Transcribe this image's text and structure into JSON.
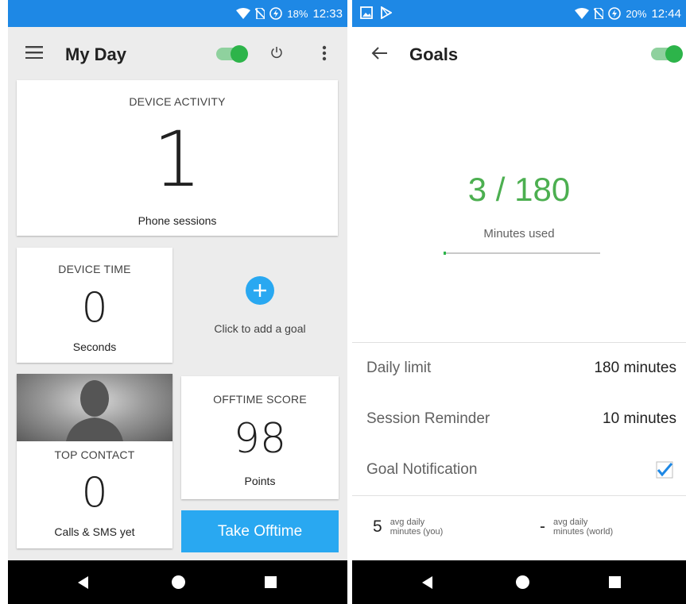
{
  "left": {
    "status": {
      "battery": "18%",
      "time": "12:33"
    },
    "appbar": {
      "title": "My Day"
    },
    "device_activity": {
      "title": "DEVICE ACTIVITY",
      "value": "1",
      "caption": "Phone sessions"
    },
    "device_time": {
      "title": "DEVICE TIME",
      "value": "0",
      "caption": "Seconds"
    },
    "add_goal": {
      "label": "Click to add a goal"
    },
    "top_contact": {
      "title": "TOP CONTACT",
      "value": "0",
      "caption": "Calls & SMS yet"
    },
    "offtime_score": {
      "title": "OFFTIME SCORE",
      "value": "98",
      "caption": "Points"
    },
    "take_offtime": {
      "label": "Take Offtime"
    }
  },
  "right": {
    "status": {
      "battery": "20%",
      "time": "12:44"
    },
    "appbar": {
      "title": "Goals"
    },
    "usage": {
      "value": "3 / 180",
      "caption": "Minutes used",
      "progress": 0.0167
    },
    "settings": [
      {
        "label": "Daily limit",
        "value": "180 minutes"
      },
      {
        "label": "Session Reminder",
        "value": "10 minutes"
      },
      {
        "label": "Goal Notification",
        "value": ""
      }
    ],
    "stats": [
      {
        "value": "5",
        "label_line1": "avg daily",
        "label_line2": "minutes (you)"
      },
      {
        "value": "-",
        "label_line1": "avg daily",
        "label_line2": "minutes (world)"
      }
    ]
  },
  "colors": {
    "status_bar": "#1e88e5",
    "accent_green": "#2db44a",
    "accent_blue": "#29a8f1",
    "goal_green": "#4caf50"
  },
  "icons": [
    "wifi-icon",
    "no-sim-icon",
    "battery-charging-icon",
    "menu-icon",
    "power-icon",
    "more-vert-icon",
    "back-arrow-icon",
    "image-icon",
    "play-store-icon",
    "plus-icon",
    "checkbox-checked-icon"
  ]
}
